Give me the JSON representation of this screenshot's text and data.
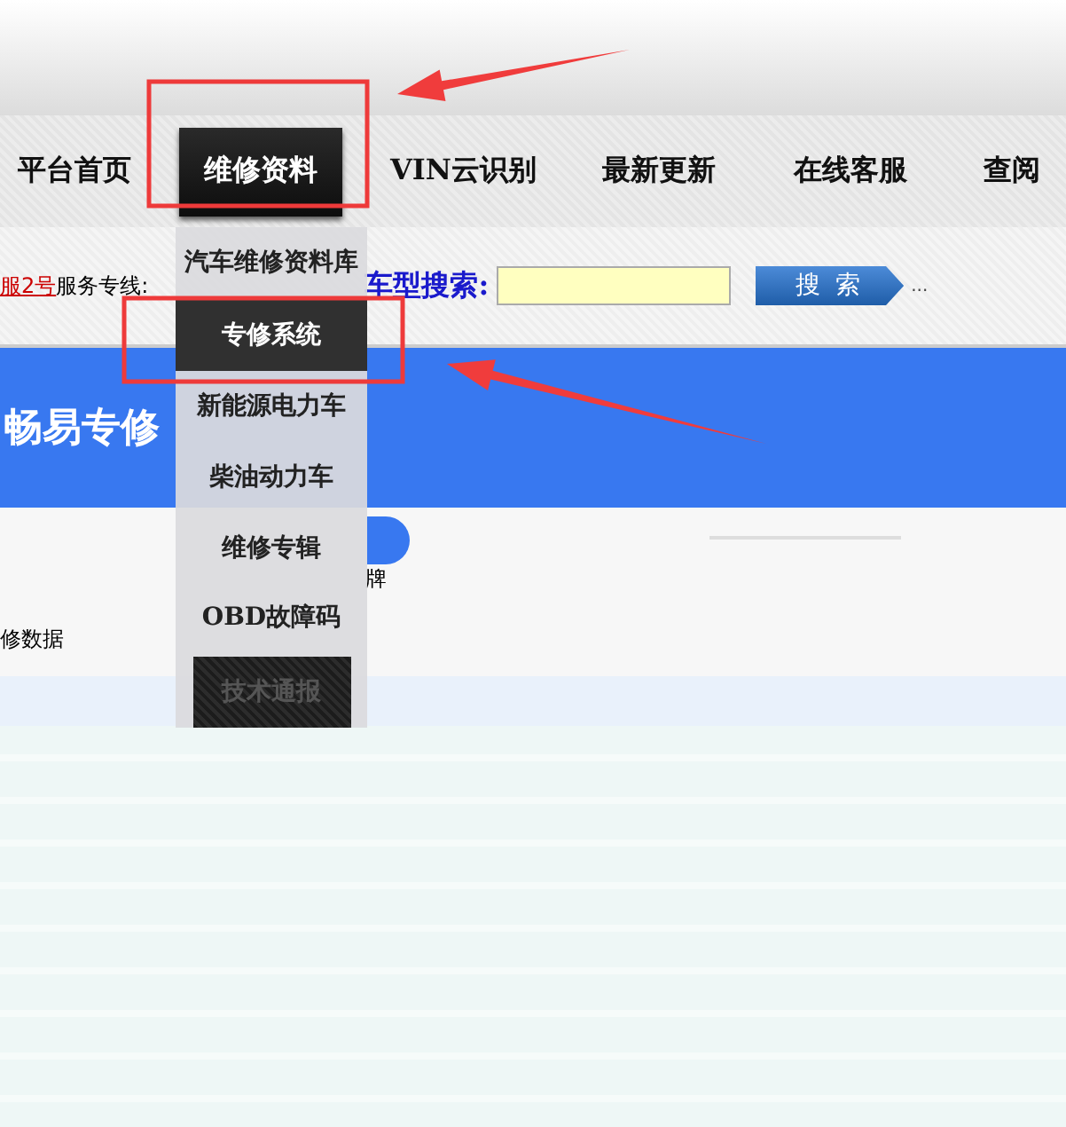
{
  "nav": {
    "items": [
      {
        "label": "平台首页",
        "selected": false
      },
      {
        "label": "维修资料",
        "selected": true
      },
      {
        "label": "VIN云识别",
        "selected": false
      },
      {
        "label": "最新更新",
        "selected": false
      },
      {
        "label": "在线客服",
        "selected": false
      },
      {
        "label": "查阅",
        "selected": false
      }
    ]
  },
  "subbar": {
    "service_link": "服2号",
    "hotline_label": "服务专线:",
    "search_label": "车型搜索:",
    "search_button": "搜 索",
    "more": "..."
  },
  "banner": {
    "title": "畅易专修"
  },
  "content": {
    "brand_hint": "牌",
    "data_label": "修数据"
  },
  "dropdown": {
    "items": [
      {
        "label": "汽车维修资料库",
        "kind": "link",
        "selected": false
      },
      {
        "label": "专修系统",
        "kind": "link",
        "selected": true
      },
      {
        "label": "新能源电力车",
        "kind": "link",
        "selected": false
      },
      {
        "label": "柴油动力车",
        "kind": "link",
        "selected": false
      },
      {
        "label": "维修专辑",
        "kind": "link",
        "selected": false
      },
      {
        "label": "OBD故障码",
        "kind": "link",
        "selected": false
      },
      {
        "label": "技术通报",
        "kind": "tab",
        "selected": false
      }
    ]
  },
  "annotations": [
    {
      "kind": "box"
    },
    {
      "kind": "arrow"
    },
    {
      "kind": "box"
    },
    {
      "kind": "arrow"
    }
  ]
}
